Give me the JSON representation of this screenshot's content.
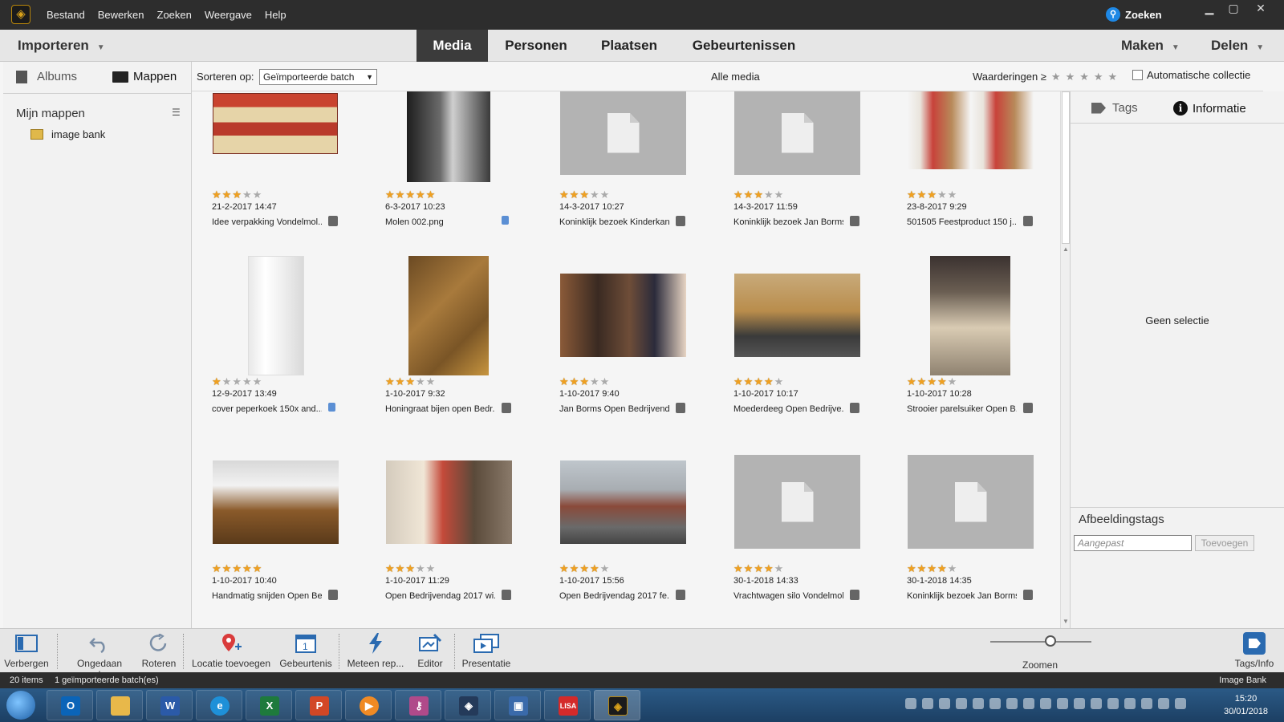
{
  "titlebar": {
    "menu": [
      "Bestand",
      "Bewerken",
      "Zoeken",
      "Weergave",
      "Help"
    ],
    "search_label": "Zoeken",
    "window_controls": [
      "minimize-icon",
      "maximize-icon",
      "close-icon"
    ]
  },
  "modebar": {
    "import_label": "Importeren",
    "tabs": [
      "Media",
      "Personen",
      "Plaatsen",
      "Gebeurtenissen"
    ],
    "active_tab": "Media",
    "make_label": "Maken",
    "share_label": "Delen"
  },
  "leftpanel": {
    "albums_label": "Albums",
    "folders_label": "Mappen",
    "my_folders_label": "Mijn mappen",
    "folder_item": "image bank"
  },
  "sortbar": {
    "sort_label": "Sorteren op:",
    "sort_value": "Geïmporteerde batch",
    "all_media": "Alle media",
    "ratings_label": "Waarderingen  ≥",
    "auto_collection": "Automatische collectie"
  },
  "media": [
    {
      "stars": 3,
      "date": "21-2-2017 14:47",
      "title": "Idee verpakking Vondelmol...",
      "badge": "stack"
    },
    {
      "stars": 5,
      "date": "6-3-2017 10:23",
      "title": "Molen 002.png",
      "badge": "blue"
    },
    {
      "stars": 3,
      "date": "14-3-2017 10:27",
      "title": "Koninklijk bezoek Kinderkan...",
      "badge": "stack"
    },
    {
      "stars": 3,
      "date": "14-3-2017 11:59",
      "title": "Koninklijk bezoek Jan Borms...",
      "badge": "stack"
    },
    {
      "stars": 3,
      "date": "23-8-2017 9:29",
      "title": "501505 Feestproduct 150 j...",
      "badge": "stack"
    },
    {
      "stars": 1,
      "date": "12-9-2017 13:49",
      "title": "cover peperkoek 150x and...",
      "badge": "blue"
    },
    {
      "stars": 3,
      "date": "1-10-2017 9:32",
      "title": "Honingraat bijen open Bedr...",
      "badge": "stack"
    },
    {
      "stars": 3,
      "date": "1-10-2017 9:40",
      "title": "Jan Borms Open Bedrijvend...",
      "badge": "stack"
    },
    {
      "stars": 4,
      "date": "1-10-2017 10:17",
      "title": "Moederdeeg Open Bedrijve...",
      "badge": "stack"
    },
    {
      "stars": 4,
      "date": "1-10-2017 10:28",
      "title": "Strooier parelsuiker Open B...",
      "badge": "stack"
    },
    {
      "stars": 5,
      "date": "1-10-2017 10:40",
      "title": "Handmatig snijden Open Be...",
      "badge": "stack"
    },
    {
      "stars": 3,
      "date": "1-10-2017 11:29",
      "title": "Open Bedrijvendag 2017 wi...",
      "badge": "stack"
    },
    {
      "stars": 4,
      "date": "1-10-2017 15:56",
      "title": "Open Bedrijvendag 2017 fe...",
      "badge": "stack"
    },
    {
      "stars": 4,
      "date": "30-1-2018 14:33",
      "title": "Vrachtwagen silo Vondelmol...",
      "badge": "stack"
    },
    {
      "stars": 4,
      "date": "30-1-2018 14:35",
      "title": "Koninklijk bezoek Jan Borms...",
      "badge": "stack"
    }
  ],
  "rightpanel": {
    "tags_label": "Tags",
    "info_label": "Informatie",
    "no_selection": "Geen selectie",
    "image_tags_title": "Afbeeldingstags",
    "tag_placeholder": "Aangepast",
    "add_label": "Toevoegen"
  },
  "toolbar": {
    "hide": "Verbergen",
    "undo": "Ongedaan maken",
    "rotate": "Roteren",
    "add_location": "Locatie toevoegen",
    "event": "Gebeurtenis",
    "instant_fix": "Meteen rep...",
    "editor": "Editor",
    "slideshow": "Presentatie",
    "zoom": "Zoomen",
    "tags_info": "Tags/Info"
  },
  "statusbar": {
    "items": "20 items",
    "batch": "1 geïmporteerde batch(es)",
    "catalog": "Image Bank"
  },
  "taskbar": {
    "time": "15:20",
    "date": "30/01/2018"
  },
  "colors": {
    "chrome_dark": "#2d2d2d",
    "star": "#f0a020",
    "accent_blue": "#1e88e5"
  }
}
